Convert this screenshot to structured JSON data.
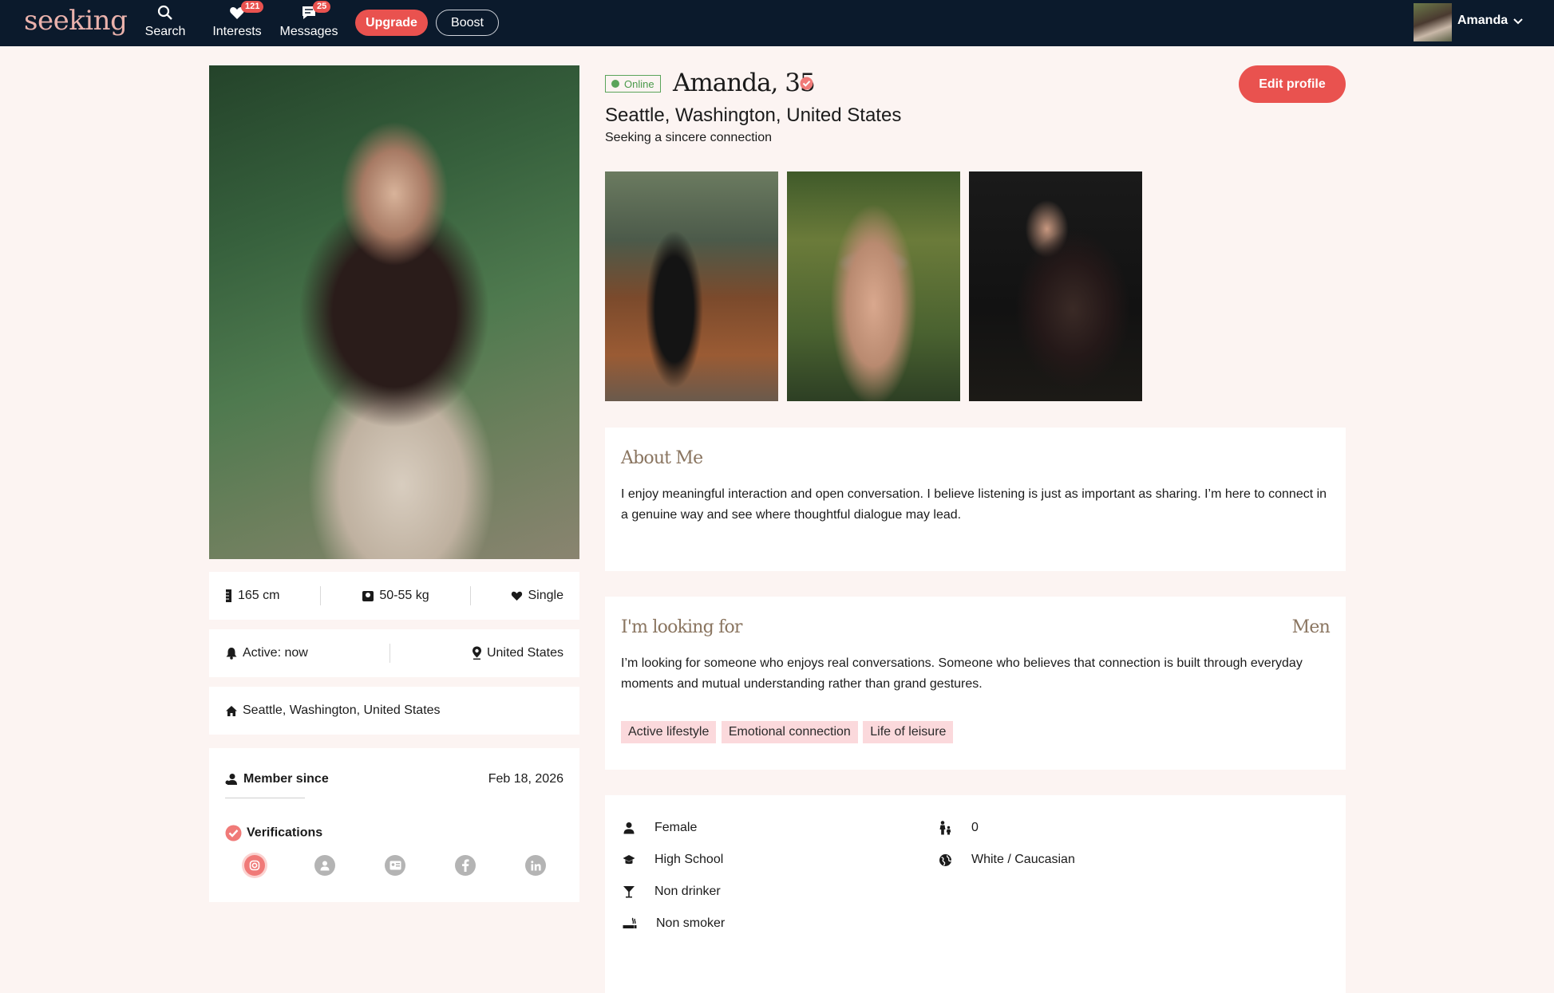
{
  "nav": {
    "logo": "seeking",
    "items": [
      {
        "label": "Search",
        "icon": "search-icon"
      },
      {
        "label": "Interests",
        "icon": "heart-icon",
        "badge": "121"
      },
      {
        "label": "Messages",
        "icon": "chat-icon",
        "badge": "25"
      }
    ],
    "upgrade_label": "Upgrade",
    "boost_label": "Boost",
    "user_name": "Amanda"
  },
  "profile": {
    "online_label": "Online",
    "name_age": "Amanda, 35",
    "location": "Seattle, Washington, United States",
    "tagline": "Seeking a sincere connection",
    "edit_label": "Edit profile"
  },
  "stats": {
    "height": "165 cm",
    "weight": "50-55 kg",
    "status": "Single",
    "active": "Active: now",
    "country": "United States",
    "home": "Seattle, Washington, United States",
    "member_since_label": "Member since",
    "member_since_value": "Feb 18, 2026",
    "verifications_label": "Verifications",
    "verification_icons": [
      "instagram-icon",
      "user-icon",
      "id-card-icon",
      "facebook-icon",
      "linkedin-icon"
    ]
  },
  "about": {
    "title": "About Me",
    "text": "I enjoy meaningful interaction and open conversation. I believe listening is just as important as sharing. I’m here to connect in a genuine way and see where thoughtful dialogue may lead."
  },
  "looking": {
    "title": "I'm looking for",
    "target": "Men",
    "text": "I’m looking for someone who enjoys real conversations. Someone who believes that connection is built through everyday moments and mutual understanding rather than grand gestures.",
    "tags": [
      "Active lifestyle",
      "Emotional connection",
      "Life of leisure"
    ]
  },
  "details": {
    "gender": "Female",
    "education": "High School",
    "drinking": "Non drinker",
    "smoking": "Non smoker",
    "children": "0",
    "ethnicity": "White / Caucasian"
  },
  "colors": {
    "accent": "#e9524f",
    "nav_bg": "#0b1a2c",
    "page_bg": "#fcf4f2",
    "online": "#5aa45a",
    "tag_bg": "#fbd9dc",
    "heading": "#8a7560"
  }
}
